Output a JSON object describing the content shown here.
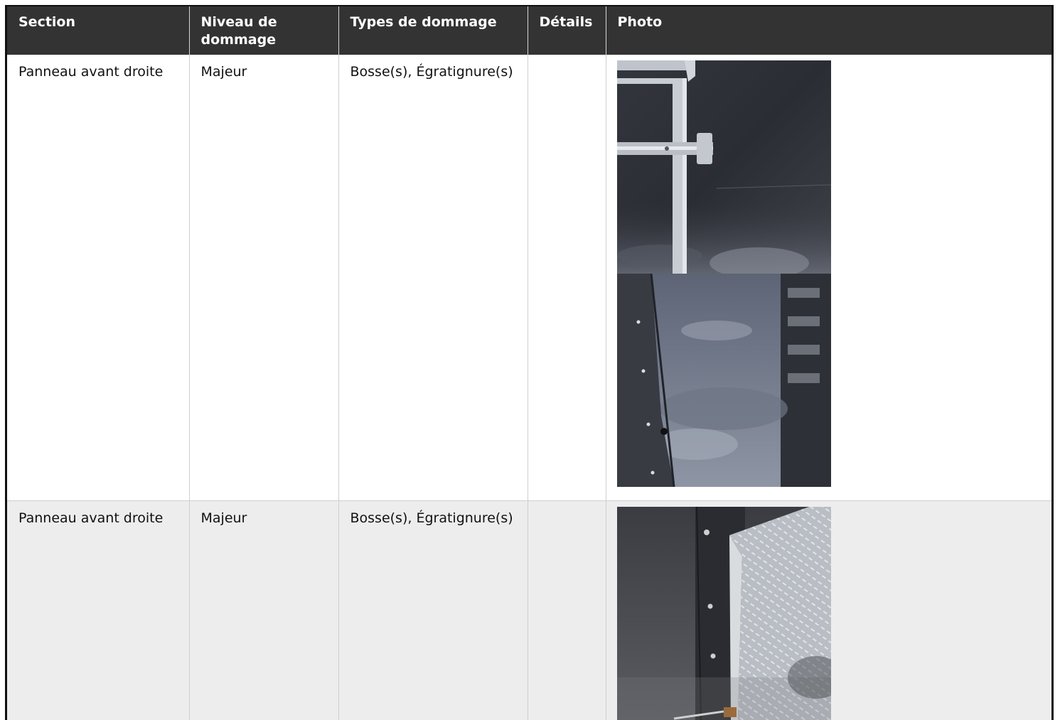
{
  "table": {
    "headers": {
      "section": "Section",
      "level": "Niveau de dommage",
      "types": "Types de dommage",
      "details": "Détails",
      "photo": "Photo"
    },
    "rows": [
      {
        "section": "Panneau avant droite",
        "level": "Majeur",
        "types": "Bosse(s), Égratignure(s)",
        "details": "",
        "photos": [
          "trailer-side-door-photo",
          "trailer-side-panel-reflection-photo"
        ]
      },
      {
        "section": "Panneau avant droite",
        "level": "Majeur",
        "types": "Bosse(s), Égratignure(s)",
        "details": "",
        "photos": [
          "trailer-fender-diamond-plate-photo"
        ]
      }
    ]
  },
  "colors": {
    "header_bg": "#333333",
    "header_text": "#ffffff",
    "alt_row_bg": "#ededed",
    "border": "#cfcfcf"
  }
}
